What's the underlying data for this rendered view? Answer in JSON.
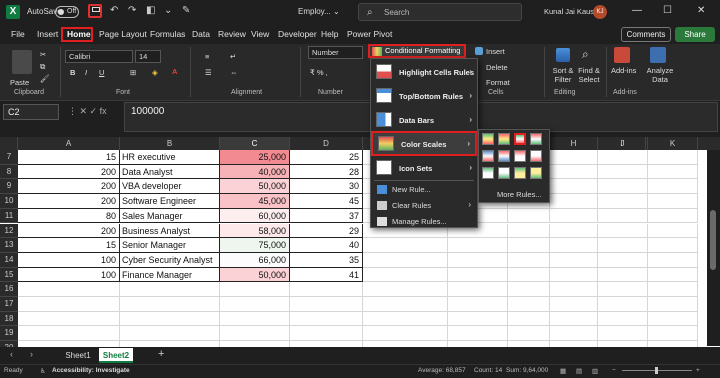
{
  "titlebar": {
    "logo": "X",
    "autosave_label": "AutoSave",
    "autosave_state": "Off",
    "doc_name": "Employ...",
    "doc_chevron": "⌄",
    "search_placeholder": "Search",
    "user_name": "Kunal Jai Kaushik",
    "user_initials": "KJ",
    "undo_icon": "↶",
    "redo_icon": "↷",
    "format_icon": "◧",
    "more_icon": "⌄",
    "pen_icon": "✎",
    "minimize": "—",
    "maximize": "☐",
    "close": "✕"
  },
  "menu": {
    "items": [
      "File",
      "Insert",
      "Home",
      "Page Layout",
      "Formulas",
      "Data",
      "Review",
      "View",
      "Developer",
      "Help",
      "Power Pivot"
    ],
    "active": "Home",
    "comments_label": "Comments",
    "share_label": "Share"
  },
  "ribbon": {
    "paste_label": "Paste",
    "font_name": "Calibri",
    "font_size": "14",
    "number_format": "Number",
    "bold": "B",
    "italic": "I",
    "underline": "U",
    "groups": [
      "Clipboard",
      "Font",
      "Alignment",
      "Number",
      "Cells",
      "Editing",
      "Add-ins"
    ],
    "conditional_formatting": "Conditional Formatting",
    "insert": "Insert",
    "delete": "Delete",
    "format": "Format",
    "sort_filter": "Sort & Filter",
    "find_select": "Find & Select",
    "addins": "Add-ins",
    "analyze_data": "Analyze Data"
  },
  "formula_bar": {
    "name_box": "C2",
    "icons": "⋮  ✕  ✓  fx",
    "value": "100000"
  },
  "grid": {
    "columns": [
      "A",
      "B",
      "C",
      "D",
      "E",
      "F",
      "G",
      "H",
      "I",
      "J",
      "K"
    ],
    "row_numbers": [
      "7",
      "8",
      "9",
      "10",
      "11",
      "12",
      "13",
      "14",
      "15",
      "16",
      "17",
      "18",
      "19",
      "20"
    ],
    "rows": [
      {
        "a": "15",
        "b": "HR executive",
        "c": "25,000",
        "d": "25",
        "c_color": "#f18a91"
      },
      {
        "a": "200",
        "b": "Data Analyst",
        "c": "40,000",
        "d": "28",
        "c_color": "#f7b2b7"
      },
      {
        "a": "200",
        "b": "VBA developer",
        "c": "50,000",
        "d": "30",
        "c_color": "#fbd2d5"
      },
      {
        "a": "200",
        "b": "Software Engineer",
        "c": "45,000",
        "d": "45",
        "c_color": "#f9c2c6"
      },
      {
        "a": "80",
        "b": "Sales Manager",
        "c": "60,000",
        "d": "37",
        "c_color": "#fdeff0"
      },
      {
        "a": "200",
        "b": "Business Analyst",
        "c": "58,000",
        "d": "29",
        "c_color": "#fde9ea"
      },
      {
        "a": "15",
        "b": "Senior Manager",
        "c": "75,000",
        "d": "40",
        "c_color": "#eef6ef"
      },
      {
        "a": "100",
        "b": "Cyber Security Analyst",
        "c": "66,000",
        "d": "35",
        "c_color": "#fcfcfc"
      },
      {
        "a": "100",
        "b": "Finance Manager",
        "c": "50,000",
        "d": "41",
        "c_color": "#fbd2d5"
      }
    ]
  },
  "cf_menu": {
    "items": [
      {
        "label": "Highlight Cells Rules",
        "arrow": "›"
      },
      {
        "label": "Top/Bottom Rules",
        "arrow": "›"
      },
      {
        "label": "Data Bars",
        "arrow": "›"
      },
      {
        "label": "Color Scales",
        "arrow": "›"
      },
      {
        "label": "Icon Sets",
        "arrow": "›"
      }
    ],
    "small_items": [
      "New Rule...",
      "Clear Rules",
      "Manage Rules..."
    ],
    "clear_arrow": "›",
    "more_rules": "More Rules..."
  },
  "sheets": {
    "tabs": [
      "Sheet1",
      "Sheet2"
    ],
    "active": "Sheet2",
    "add": "+",
    "nav_prev": "‹",
    "nav_next": "›"
  },
  "status": {
    "ready": "Ready",
    "accessibility": "Accessibility: Investigate",
    "average": "Average: 68,857",
    "count": "Count: 14",
    "sum": "Sum: 9,64,000",
    "zoom_minus": "−",
    "zoom_plus": "+"
  }
}
